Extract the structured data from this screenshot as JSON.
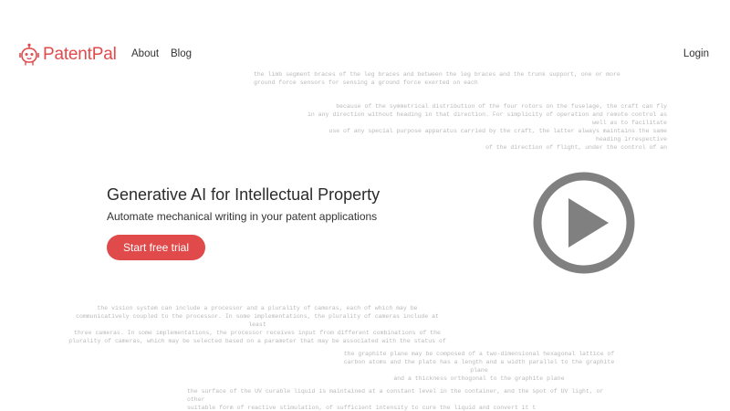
{
  "nav": {
    "logo_text": "PatentPal",
    "links": [
      {
        "label": "About"
      },
      {
        "label": "Blog"
      }
    ],
    "login_label": "Login"
  },
  "hero": {
    "title": "Generative AI for Intellectual Property",
    "subtitle": "Automate mechanical writing in your patent applications",
    "cta_label": "Start free trial"
  },
  "background_snippets": [
    "the limb segment braces of the leg braces and between the leg braces and the trunk support, one or more\nground force sensors for sensing a ground force exerted on each",
    "because of the symmetrical distribution of the four rotors on the fuselage, the craft can fly\nin any direction without heading in that direction. For simplicity of operation and remote control as well as to facilitate\nuse of any special purpose apparatus carried by the craft, the latter always maintains the same heading irrespective\nof the direction of flight, under the control of an",
    "the vision system can include a processor and a plurality of cameras, each of which may be\ncommunicatively coupled to the processor. In some implementations, the plurality of cameras include at least\nthree cameras. In some implementations, the processor receives input from different combinations of the\nplurality of cameras, which may be selected based on a parameter that may be associated with the status of",
    "the graphite plane may be composed of a two-dimensional hexagonal lattice of\ncarbon atoms and the plate has a length and a width parallel to the graphite plane\nand a thickness orthogonal to the graphite plane",
    "the surface of the UV curable liquid is maintained at a constant level in the container, and the spot of UV light, or other\nsuitable form of reactive stimulation, of sufficient intensity to cure the liquid and convert it t"
  ],
  "colors": {
    "brand": "#e04a4a",
    "play_icon": "#808080"
  },
  "icons": {
    "logo": "robot-head-icon",
    "video": "play-button-icon"
  }
}
